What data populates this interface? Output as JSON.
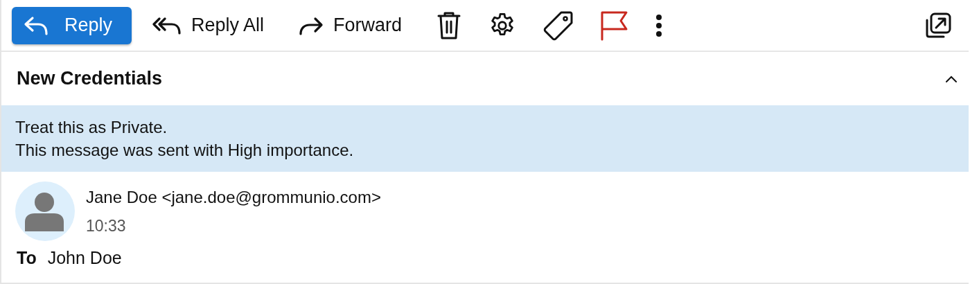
{
  "toolbar": {
    "reply_label": "Reply",
    "reply_all_label": "Reply All",
    "forward_label": "Forward",
    "flagged": true
  },
  "message": {
    "subject": "New Credentials",
    "expanded": true,
    "notices": [
      "Treat this as Private.",
      "This message was sent with High importance."
    ],
    "sender": "Jane Doe <jane.doe@grommunio.com>",
    "time": "10:33",
    "to_label": "To",
    "to": "John Doe"
  }
}
